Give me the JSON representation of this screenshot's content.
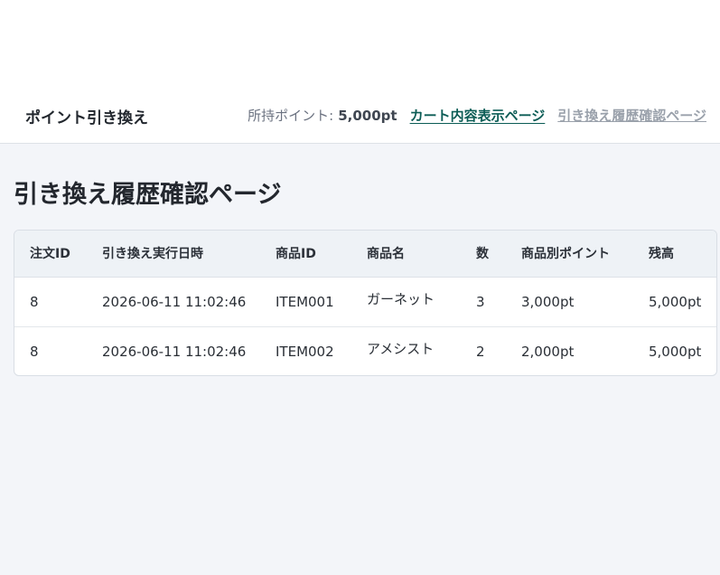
{
  "header": {
    "brand": "ポイント引き換え",
    "points_label": "所持ポイント:",
    "points_value": "5,000pt",
    "nav_cart": "カート内容表示ページ",
    "nav_history": "引き換え履歴確認ページ",
    "colors": {
      "link_active": "#0b5c55",
      "link_inactive": "#9aa1ab"
    }
  },
  "main": {
    "title": "引き換え履歴確認ページ",
    "table": {
      "columns": [
        "注文ID",
        "引き換え実行日時",
        "商品ID",
        "商品名",
        "数",
        "商品別ポイント",
        "残高"
      ],
      "rows": [
        [
          "8",
          "2026-06-11 11:02:46",
          "ITEM001",
          "ガーネット",
          "3",
          "3,000pt",
          "5,000pt"
        ],
        [
          "8",
          "2026-06-11 11:02:46",
          "ITEM002",
          "アメシスト",
          "2",
          "2,000pt",
          "5,000pt"
        ]
      ]
    }
  }
}
